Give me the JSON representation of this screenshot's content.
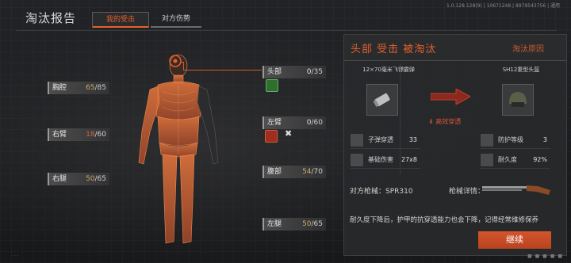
{
  "header": {
    "title": "淘汰报告",
    "version": "1.0.128.128(9) | 10671248 | 8979543756 | 通用",
    "tabs": [
      {
        "label": "我的受击",
        "active": true
      },
      {
        "label": "对方伤势",
        "active": false
      }
    ]
  },
  "body_parts": {
    "thorax": {
      "name": "胸腔",
      "current": "65",
      "max": "/85"
    },
    "right_arm": {
      "name": "右臂",
      "current": "18",
      "max": "/60"
    },
    "right_leg": {
      "name": "右腿",
      "current": "50",
      "max": "/65"
    },
    "head": {
      "name": "头部",
      "current": "0",
      "max": "/35"
    },
    "left_arm": {
      "name": "左臂",
      "current": "0",
      "max": "/60"
    },
    "stomach": {
      "name": "腹部",
      "current": "54",
      "max": "/70"
    },
    "left_leg": {
      "name": "左腿",
      "current": "50",
      "max": "/65"
    }
  },
  "status_icons": [
    "hearing-icon",
    "bleeding-icon",
    "cross-icon"
  ],
  "report": {
    "title": "头部  受击  被淘汰",
    "reason": "淘汰原因",
    "ammo": {
      "name": "12×70毫米飞镖霰弹",
      "stats": [
        {
          "icon": "penetration-icon",
          "label": "子弹穿透",
          "value": "33"
        },
        {
          "icon": "damage-icon",
          "label": "基础伤害",
          "value": "27x8"
        }
      ]
    },
    "effect": "高效穿透",
    "armor": {
      "name": "SH12重型头盔",
      "stats": [
        {
          "icon": "armor-icon",
          "label": "防护等级",
          "value": "3"
        },
        {
          "icon": "durability-icon",
          "label": "耐久度",
          "value": "92%"
        }
      ]
    },
    "weapon_label": "对方枪械：",
    "weapon_name": "SPR310",
    "weapon_detail": "枪械详情：",
    "note": "耐久度下降后，护甲的抗穿透能力也会下降，记得经常维修保养",
    "continue_label": "继续"
  },
  "colors": {
    "accent": "#e5602d",
    "panel": "#28292b",
    "bg": "#1b1c1e"
  }
}
